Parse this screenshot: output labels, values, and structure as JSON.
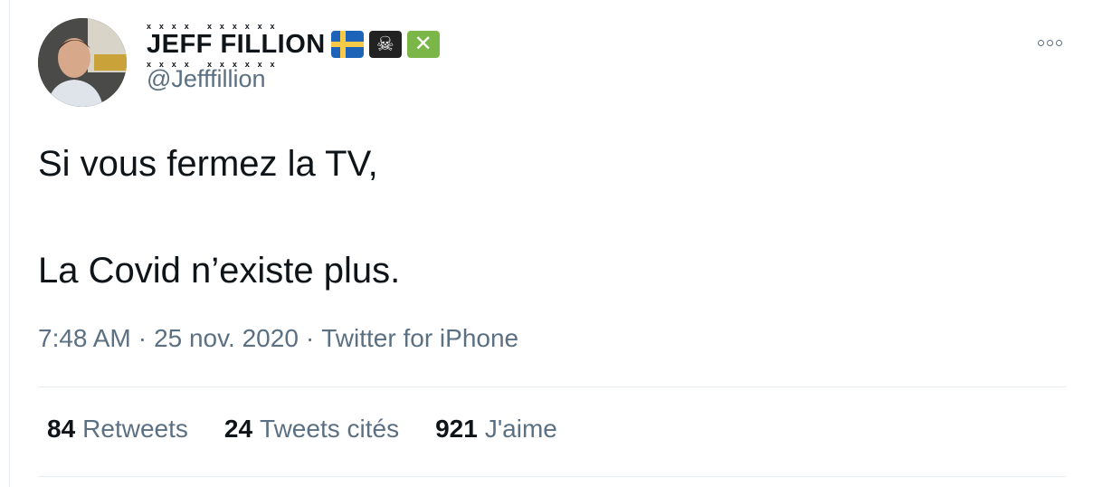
{
  "author": {
    "display_name": "JEFF FILLION",
    "handle": "@Jefffillion",
    "emojis": [
      "sweden-flag",
      "pirate-flag",
      "cross-mark"
    ]
  },
  "tweet": {
    "line1": "Si vous fermez la TV,",
    "line2": "La Covid n’existe plus.",
    "time": "7:48 AM",
    "date": "25 nov. 2020",
    "source": "Twitter for iPhone",
    "separator": "·"
  },
  "stats": {
    "retweets_count": "84",
    "retweets_label": "Retweets",
    "quotes_count": "24",
    "quotes_label": "Tweets cités",
    "likes_count": "921",
    "likes_label": "J'aime"
  },
  "colors": {
    "text": "#0f1419",
    "secondary": "#5b7083",
    "divider": "#e6ecf0"
  }
}
